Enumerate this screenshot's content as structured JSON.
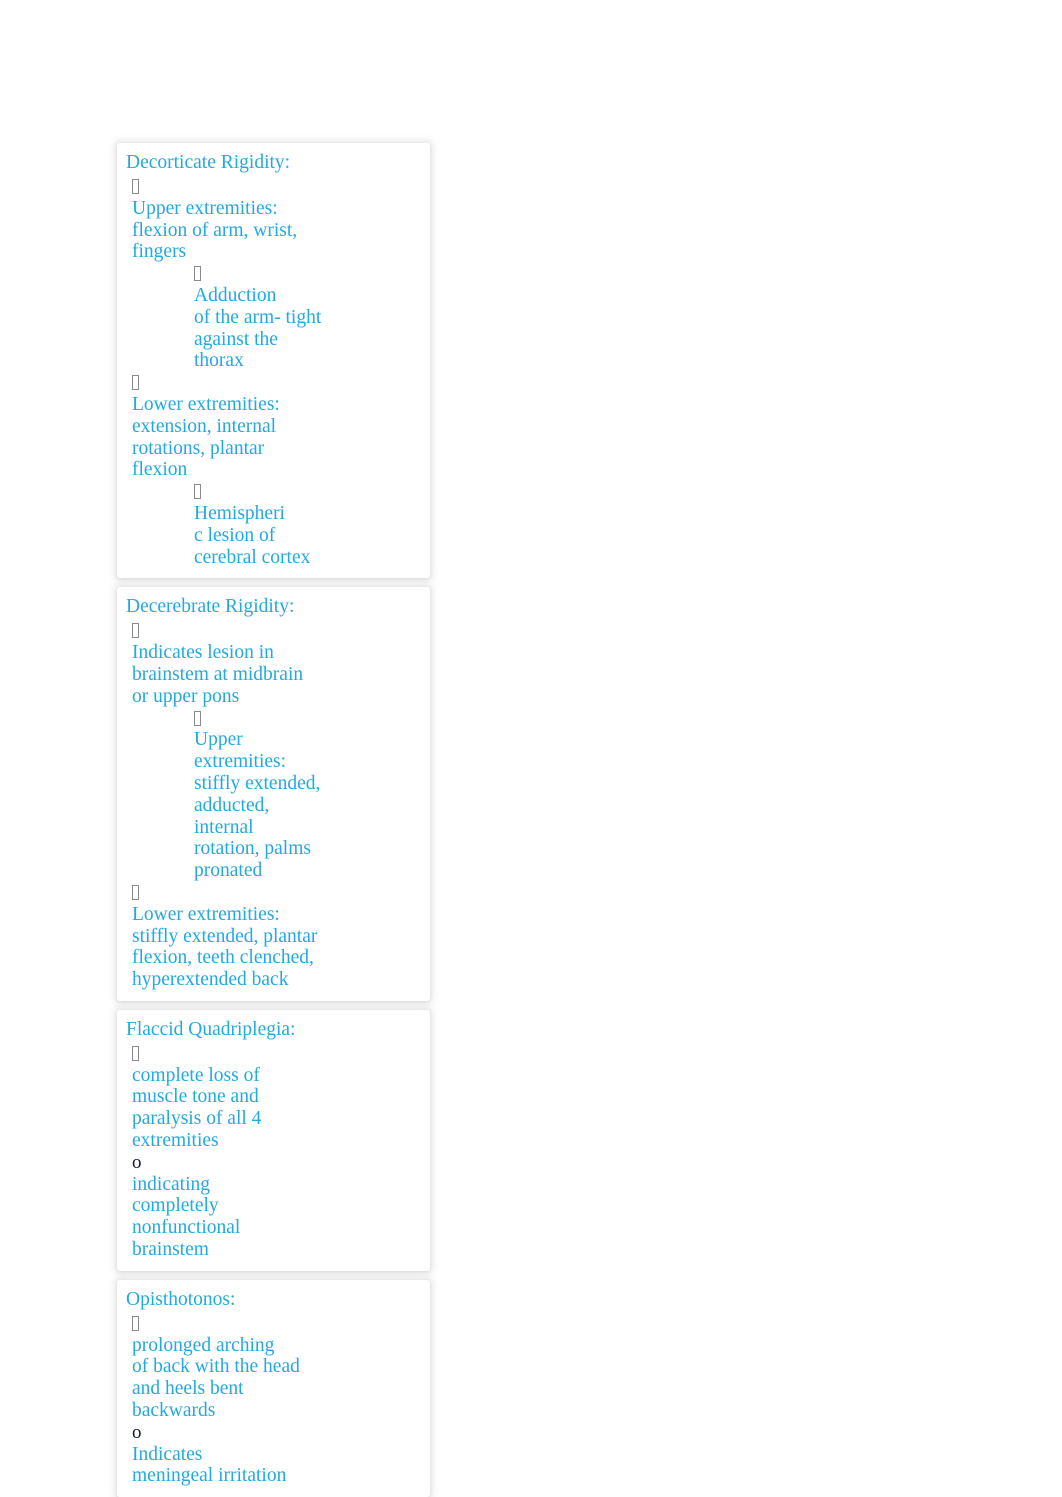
{
  "document": {
    "text_color": "#23a9e2",
    "bullet_color": "#8b8b8b",
    "sub_bullet_color": "#151b30",
    "background": "#ffffff",
    "bullet_glyph": "tofu-box-missing-glyph",
    "sub_bullet_glyph": "o"
  },
  "sections": [
    {
      "heading": "Decorticate Rigidity:",
      "blocks": [
        {
          "level": 1,
          "bullet": "tofu",
          "lines": [
            "Upper extremities:",
            "flexion of arm, wrist,",
            "fingers"
          ]
        },
        {
          "level": 2,
          "bullet": "tofu",
          "lines": [
            "Adduction",
            "of the arm- tight",
            "against the",
            "thorax"
          ]
        },
        {
          "level": 1,
          "bullet": "tofu",
          "lines": [
            "Lower extremities:",
            "extension, internal",
            "rotations, plantar",
            "flexion"
          ]
        },
        {
          "level": 2,
          "bullet": "tofu",
          "lines": [
            "Hemispheri",
            "c lesion of",
            "cerebral cortex"
          ]
        }
      ]
    },
    {
      "heading": "Decerebrate Rigidity:",
      "blocks": [
        {
          "level": 1,
          "bullet": "tofu",
          "lines": [
            "Indicates lesion in",
            "brainstem at midbrain",
            "or upper pons"
          ]
        },
        {
          "level": 2,
          "bullet": "tofu",
          "lines": [
            "Upper",
            "extremities:",
            "stiffly extended,",
            "adducted,",
            "internal",
            "rotation, palms",
            "pronated"
          ]
        },
        {
          "level": 1,
          "bullet": "tofu",
          "lines": [
            "Lower extremities:",
            "stiffly extended, plantar",
            "flexion, teeth clenched,",
            "hyperextended back"
          ]
        }
      ]
    },
    {
      "heading": "Flaccid Quadriplegia:",
      "blocks": [
        {
          "level": 1,
          "bullet": "tofu",
          "lines": [
            "complete loss of",
            "muscle tone and",
            "paralysis of all 4",
            "extremities"
          ]
        },
        {
          "level": 1,
          "bullet": "o",
          "lines": [
            "indicating",
            "completely",
            "nonfunctional",
            "brainstem"
          ]
        }
      ]
    },
    {
      "heading": "Opisthotonos:",
      "blocks": [
        {
          "level": 1,
          "bullet": "tofu",
          "lines": [
            "prolonged arching",
            "of back with the head",
            "and heels bent",
            "backwards"
          ]
        },
        {
          "level": 1,
          "bullet": "o",
          "lines": [
            "Indicates",
            "meningeal irritation"
          ]
        }
      ]
    }
  ]
}
